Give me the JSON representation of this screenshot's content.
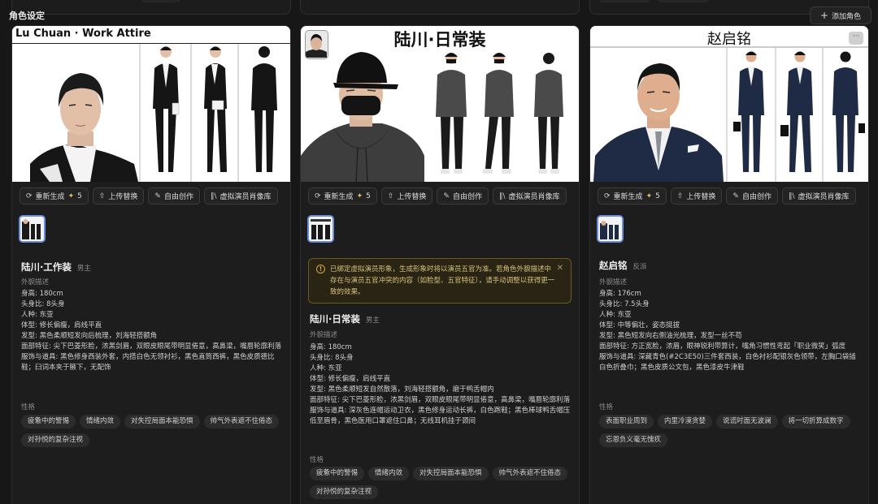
{
  "section_title": "角色设定",
  "add_button": "添加角色",
  "actions": {
    "regenerate": "重新生成",
    "regenerate_cost": "5",
    "upload": "上传替换",
    "free_create": "自由创作",
    "virtual_library": "虚拟演员肖像库"
  },
  "labels": {
    "appearance": "外貌描述",
    "personality": "性格"
  },
  "cards": [
    {
      "sheet_title": "Lu Chuan · Work Attire",
      "name": "陆川·工作装",
      "role": "男主",
      "appearance": [
        "身高: 180cm",
        "头身比: 8头身",
        "人种: 东亚",
        "体型: 修长偏瘦，肩线平直",
        "发型: 黑色柔顺短发向后梳理，刘海轻搭额角",
        "面部特征: 尖下巴菱形脸，浓黑剑眉，双眼皮眼尾带明显倦意，高鼻梁，嘴唇轮廓利落",
        "服饰与道具: 黑色修身西装外套，内搭白色无领衬衫，黑色直筒西裤，黑色皮质德比鞋；臼词本夹于腋下，无配饰"
      ],
      "tags": [
        "疲惫中的警惕",
        "情绪内敛",
        "对失控局面本能恐惧",
        "帅气外表遮不住倦态",
        "对孙悦的复杂注视"
      ]
    },
    {
      "sheet_title": "陆川·日常装",
      "name": "陆川·日常装",
      "role": "男主",
      "notice": "已绑定虚拟演员形象，生成形象时将以演员五官为准。若角色外貌描述中存在与演员五官冲突的内容（如脸型、五官特征），请手动调整以获得更一致的效果。",
      "appearance": [
        "身高: 180cm",
        "头身比: 8头身",
        "人种: 东亚",
        "体型: 修长偏瘦，肩线平直",
        "发型: 黑色柔顺短发自然散落，刘海轻搭额角，磨于鸭舌帽内",
        "面部特征: 尖下巴菱形脸，浓黑剑眉，双眼皮眼尾带明显倦意，高鼻梁，嘴唇轮廓利落",
        "服饰与道具: 深灰色连帽运动卫衣，黑色修身运动长裤，白色跑鞋；黑色棒球鸭舌帽压低至眉骨，黑色医用口罩遮住口鼻；无线耳机挂于颈间"
      ],
      "tags": [
        "疲惫中的警惕",
        "情绪内敛",
        "对失控局面本能恐惧",
        "帅气外表遮不住倦态",
        "对孙悦的复杂注视"
      ]
    },
    {
      "sheet_title": "赵启铭",
      "name": "赵启铭",
      "role": "反派",
      "appearance": [
        "身高: 176cm",
        "头身比: 7.5头身",
        "人种: 东亚",
        "体型: 中等偏壮，姿态挺拔",
        "发型: 黑色短发向右侧油光梳理，发型一丝不苟",
        "面部特征: 方正宽脸，浓眉，眼神锐利带算计，嘴角习惯性弯起「职业微笑」弧度",
        "服饰与道具: 深藏青色(#2C3E50)三件套西装，白色衬衫配银灰色领带，左胸口袋插白色折叠巾；黑色皮质公文包，黑色漆皮牛津鞋"
      ],
      "tags": [
        "表面职业周到",
        "内里冷漠贪婪",
        "说谎时面无波澜",
        "将一切折算成数字",
        "忘恩负义毫无愧疚"
      ]
    }
  ]
}
